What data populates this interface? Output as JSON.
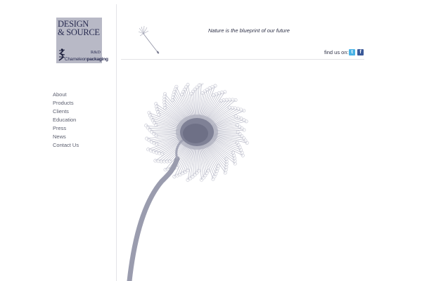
{
  "logo": {
    "line1": "DESIGN",
    "line2": "& SOURCE",
    "rd": "R&D",
    "brand_light": "Chameleon",
    "brand_bold": "packaging",
    "icon": "gecko-icon"
  },
  "nav": {
    "items": [
      {
        "label": "About"
      },
      {
        "label": "Products"
      },
      {
        "label": "Clients"
      },
      {
        "label": "Education"
      },
      {
        "label": "Press"
      },
      {
        "label": "News"
      },
      {
        "label": "Contact Us"
      }
    ]
  },
  "header": {
    "tagline": "Nature is the blueprint of our future",
    "find_us": "find us on:",
    "social": [
      {
        "name": "twitter",
        "glyph": "t",
        "color": "#4ab3e6"
      },
      {
        "name": "facebook",
        "glyph": "f",
        "color": "#3b5998"
      }
    ]
  },
  "colors": {
    "logo_bg": "#b8b9c6",
    "logo_text": "#2a2d52",
    "nav_text": "#5b5e6e",
    "dandelion": "#9a9cae"
  }
}
